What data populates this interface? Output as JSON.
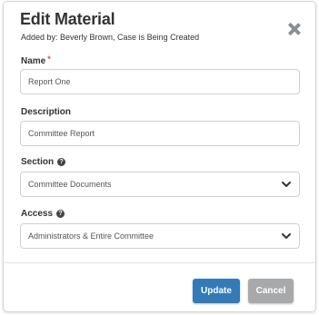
{
  "dialog": {
    "title": "Edit Material",
    "subtitle": "Added by: Beverly Brown, Case is Being Created"
  },
  "icons": {
    "close": "close-icon",
    "help": "help-circle-icon",
    "dropdown": "chevron-down-icon"
  },
  "fields": {
    "name": {
      "label": "Name",
      "required_marker": "*",
      "value": "Report One"
    },
    "description": {
      "label": "Description",
      "value": "Committee Report"
    },
    "section": {
      "label": "Section",
      "help_glyph": "?",
      "selected": "Committee Documents"
    },
    "access": {
      "label": "Access",
      "help_glyph": "?",
      "selected": "Administrators & Entire Committee"
    }
  },
  "buttons": {
    "update_label": "Update",
    "cancel_label": "Cancel"
  },
  "colors": {
    "primary": "#337ab7",
    "secondary": "#a8a9ab",
    "required": "#d9534f"
  }
}
